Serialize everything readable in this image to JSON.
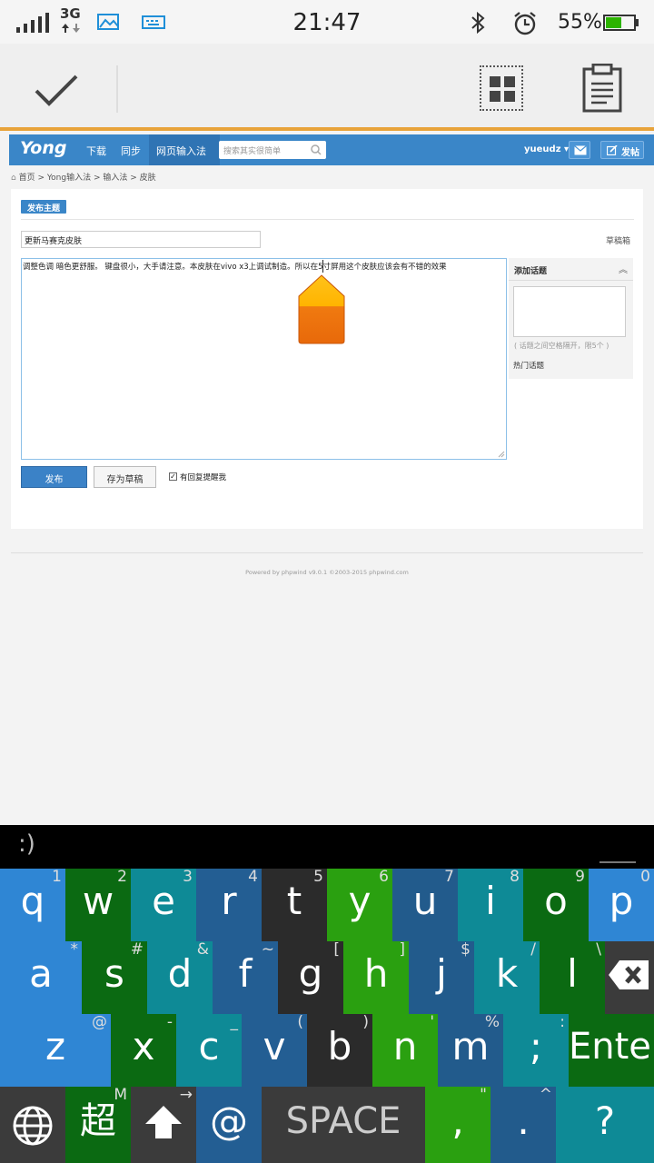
{
  "status_bar": {
    "signal": "signal-bars-icon",
    "network": "3G",
    "time": "21:47",
    "battery_percent": "55%",
    "battery_level": 0.55,
    "battery_color": "#2db400"
  },
  "action_bar": {
    "confirm_icon": "checkmark-icon",
    "grid_icon": "select-all-icon",
    "clipboard_icon": "clipboard-icon"
  },
  "site": {
    "logo": "Yong",
    "nav": [
      "下载",
      "同步",
      "网页输入法"
    ],
    "search_placeholder": "搜索其实很简单",
    "user": "yueudz",
    "post_label": "发帖",
    "brand_color": "#3a86c8"
  },
  "breadcrumb": "首页 > Yong输入法 > 输入法 > 皮肤",
  "form": {
    "section_label": "发布主题",
    "title_value": "更新马赛克皮肤",
    "drafts_link": "草稿箱",
    "editor_text": "调整色调 暗色更舒服。 键盘很小，大手请注意。本皮肤在vivo x3上调试制造。所以在5寸屏用这个皮肤应该会有不错的效果",
    "side_title": "添加话题",
    "topic_hint": "( 话题之间空格隔开，限5个 )",
    "hot_topics": "热门话题",
    "publish_button": "发布",
    "draft_button": "存为草稿",
    "notify_checked": true,
    "notify_label": "有回复提醒我"
  },
  "footer": "Powered by phpwind v9.0.1 ©2003-2015 phpwind.com",
  "candidate_bar": {
    "emoticon": ":)"
  },
  "keyboard": {
    "rows": [
      [
        {
          "label": "q",
          "sub": "1",
          "color": "#2f86d4"
        },
        {
          "label": "w",
          "sub": "2",
          "color": "#0b6a12"
        },
        {
          "label": "e",
          "sub": "3",
          "color": "#0e8a96"
        },
        {
          "label": "r",
          "sub": "4",
          "color": "#235e93"
        },
        {
          "label": "t",
          "sub": "5",
          "color": "#2b2b2b"
        },
        {
          "label": "y",
          "sub": "6",
          "color": "#2aa010"
        },
        {
          "label": "u",
          "sub": "7",
          "color": "#225b8c"
        },
        {
          "label": "i",
          "sub": "8",
          "color": "#0e8a96"
        },
        {
          "label": "o",
          "sub": "9",
          "color": "#0b6a12"
        },
        {
          "label": "p",
          "sub": "0",
          "color": "#2f86d4"
        }
      ],
      [
        {
          "label": "a",
          "sub": "*",
          "color": "#2f86d4"
        },
        {
          "label": "s",
          "sub": "#",
          "color": "#0b6a12"
        },
        {
          "label": "d",
          "sub": "&",
          "color": "#0e8a96"
        },
        {
          "label": "f",
          "sub": "~",
          "color": "#235e93"
        },
        {
          "label": "g",
          "sub": "[",
          "color": "#2b2b2b"
        },
        {
          "label": "h",
          "sub": "]",
          "color": "#2aa010"
        },
        {
          "label": "j",
          "sub": "$",
          "color": "#225b8c"
        },
        {
          "label": "k",
          "sub": "/",
          "color": "#0e8a96"
        },
        {
          "label": "l",
          "sub": "\\",
          "color": "#0b6a12"
        },
        {
          "label": "backspace-icon",
          "sub": "",
          "color": "#3b3b3b"
        }
      ],
      [
        {
          "label": "z",
          "sub": "@",
          "color": "#2f86d4"
        },
        {
          "label": "x",
          "sub": "-",
          "color": "#0b6a12"
        },
        {
          "label": "c",
          "sub": "_",
          "color": "#0e8a96"
        },
        {
          "label": "v",
          "sub": "(",
          "color": "#235e93"
        },
        {
          "label": "b",
          "sub": ")",
          "color": "#2b2b2b"
        },
        {
          "label": "n",
          "sub": "'",
          "color": "#2aa010"
        },
        {
          "label": "m",
          "sub": "%",
          "color": "#225b8c"
        },
        {
          "label": ";",
          "sub": ":",
          "color": "#0e8a96"
        },
        {
          "label": "Enter",
          "sub": "",
          "color": "#0b6a12"
        }
      ],
      [
        {
          "label": "globe-icon",
          "sub": "",
          "color": "#3b3b3b"
        },
        {
          "label": "超",
          "sub": "M",
          "color": "#0b6a12"
        },
        {
          "label": "shift-arrow-icon",
          "sub": "→",
          "color": "#3b3b3b"
        },
        {
          "label": "@",
          "sub": "",
          "color": "#235e93"
        },
        {
          "label": "SPACE",
          "sub": "",
          "color": "#3b3b3b"
        },
        {
          "label": ",",
          "sub": "\"",
          "color": "#2aa010"
        },
        {
          "label": ".",
          "sub": "^",
          "color": "#225b8c"
        },
        {
          "label": "?",
          "sub": "",
          "color": "#0e8a96"
        }
      ]
    ]
  }
}
